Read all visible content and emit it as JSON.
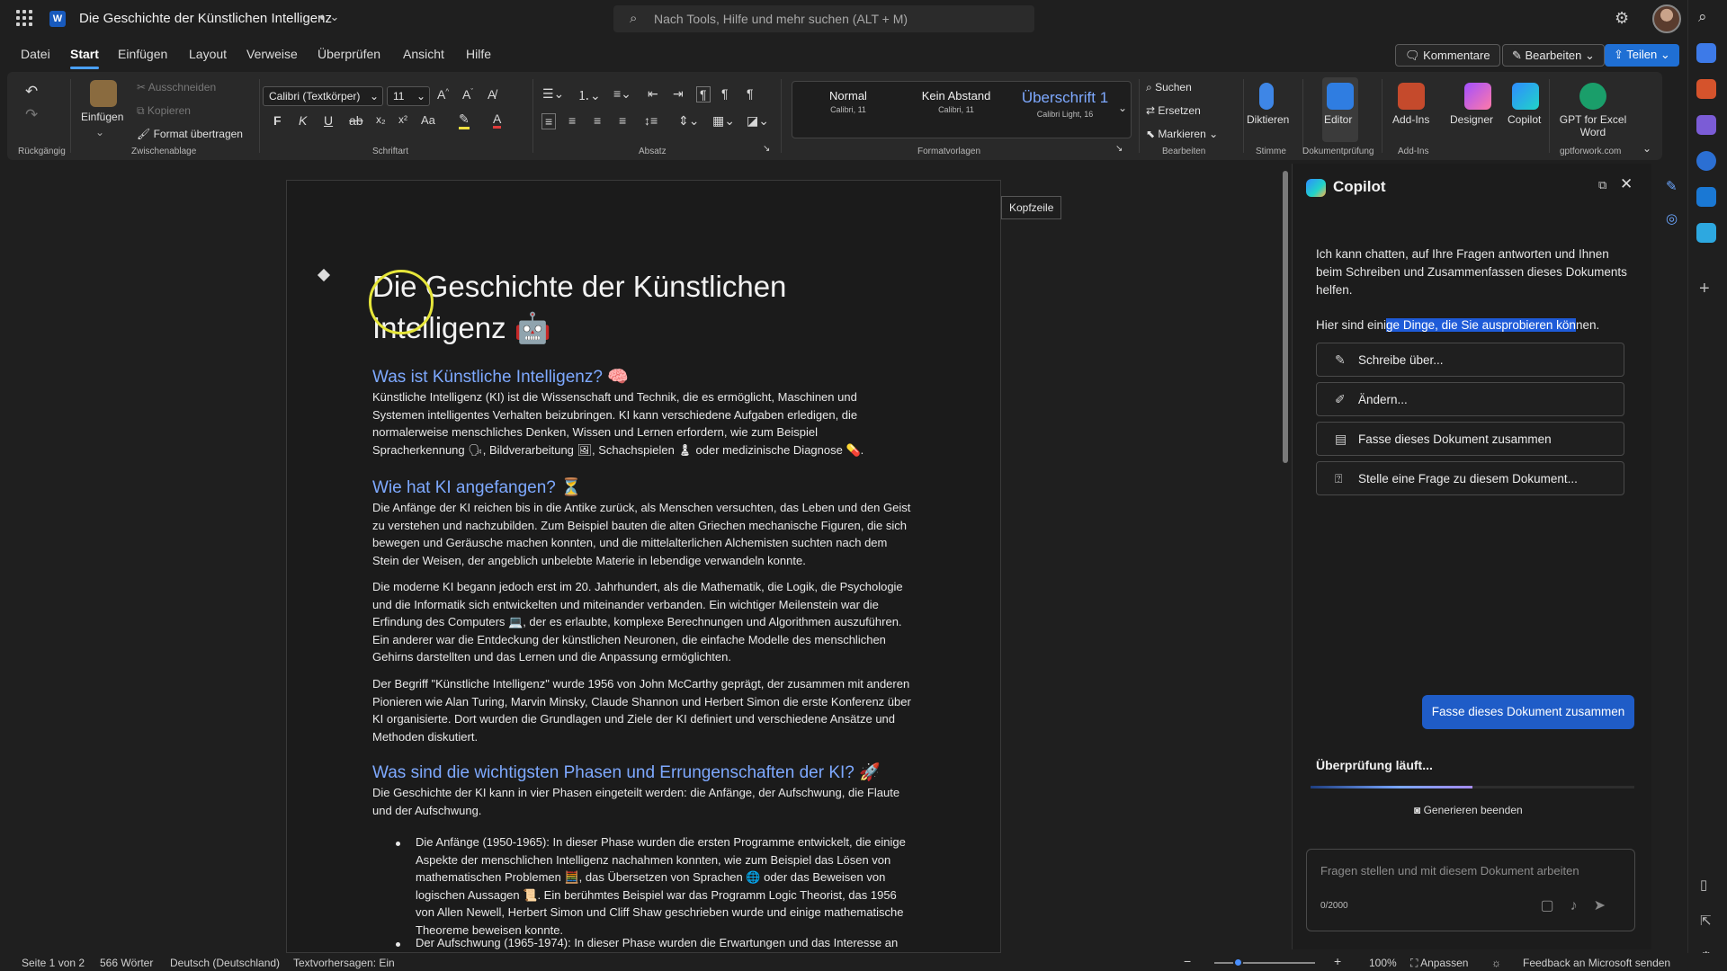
{
  "titlebar": {
    "doc_title": "Die Geschichte der Künstlichen Intelligenz",
    "search_placeholder": "Nach Tools, Hilfe und mehr suchen (ALT + M)"
  },
  "tabs": [
    "Datei",
    "Start",
    "Einfügen",
    "Layout",
    "Verweise",
    "Überprüfen",
    "Ansicht",
    "Hilfe"
  ],
  "active_tab": "Start",
  "actions": {
    "comments": "Kommentare",
    "edit": "Bearbeiten",
    "share": "Teilen"
  },
  "ribbon": {
    "undo_group": "Rückgängig",
    "clipboard": {
      "paste": "Einfügen",
      "cut": "Ausschneiden",
      "copy": "Kopieren",
      "format_painter": "Format übertragen",
      "group": "Zwischenablage"
    },
    "font": {
      "name": "Calibri (Textkörper)",
      "size": "11",
      "group": "Schriftart",
      "bold": "F",
      "italic": "K",
      "underline": "U",
      "case": "Aa"
    },
    "paragraph": {
      "group": "Absatz"
    },
    "styles": {
      "items": [
        {
          "name": "Normal",
          "sub": "Calibri, 11"
        },
        {
          "name": "Kein Abstand",
          "sub": "Calibri, 11"
        },
        {
          "name": "Überschrift 1",
          "sub": "Calibri Light, 16"
        }
      ],
      "group": "Formatvorlagen"
    },
    "editing": {
      "find": "Suchen",
      "replace": "Ersetzen",
      "select": "Markieren",
      "group": "Bearbeiten"
    },
    "voice": {
      "dictate": "Diktieren",
      "group": "Stimme"
    },
    "review": {
      "editor": "Editor",
      "group": "Dokumentprüfung"
    },
    "addins": {
      "label": "Add-Ins",
      "group": "Add-Ins"
    },
    "designer": "Designer",
    "copilot": "Copilot",
    "gpt": {
      "line1": "GPT for Excel",
      "line2": "Word",
      "group": "gptforwork.com"
    }
  },
  "document": {
    "header_label": "Kopfzeile",
    "title": "Die Geschichte der Künstlichen Intelligenz 🤖",
    "sections": [
      {
        "heading": "Was ist Künstliche Intelligenz? 🧠",
        "paragraphs": [
          "Künstliche Intelligenz (KI) ist die Wissenschaft und Technik, die es ermöglicht, Maschinen und Systemen intelligentes Verhalten beizubringen. KI kann verschiedene Aufgaben erledigen, die normalerweise menschliches Denken, Wissen und Lernen erfordern, wie zum Beispiel Spracherkennung 🗣, Bildverarbeitung 🖼, Schachspielen ♟ oder medizinische Diagnose 💊."
        ]
      },
      {
        "heading": "Wie hat KI angefangen? ⏳",
        "paragraphs": [
          "Die Anfänge der KI reichen bis in die Antike zurück, als Menschen versuchten, das Leben und den Geist zu verstehen und nachzubilden. Zum Beispiel bauten die alten Griechen mechanische Figuren, die sich bewegen und Geräusche machen konnten, und die mittelalterlichen Alchemisten suchten nach dem Stein der Weisen, der angeblich unbelebte Materie in lebendige verwandeln konnte.",
          "Die moderne KI begann jedoch erst im 20. Jahrhundert, als die Mathematik, die Logik, die Psychologie und die Informatik sich entwickelten und miteinander verbanden. Ein wichtiger Meilenstein war die Erfindung des Computers 💻, der es erlaubte, komplexe Berechnungen und Algorithmen auszuführen. Ein anderer war die Entdeckung der künstlichen Neuronen, die einfache Modelle des menschlichen Gehirns darstellten und das Lernen und die Anpassung ermöglichten.",
          "Der Begriff \"Künstliche Intelligenz\" wurde 1956 von John McCarthy geprägt, der zusammen mit anderen Pionieren wie Alan Turing, Marvin Minsky, Claude Shannon und Herbert Simon die erste Konferenz über KI organisierte. Dort wurden die Grundlagen und Ziele der KI definiert und verschiedene Ansätze und Methoden diskutiert."
        ]
      },
      {
        "heading": "Was sind die wichtigsten Phasen und Errungenschaften der KI? 🚀",
        "paragraphs": [
          "Die Geschichte der KI kann in vier Phasen eingeteilt werden: die Anfänge, der Aufschwung, die Flaute und der Aufschwung."
        ],
        "bullets": [
          "Die Anfänge (1950-1965): In dieser Phase wurden die ersten Programme entwickelt, die einige Aspekte der menschlichen Intelligenz nachahmen konnten, wie zum Beispiel das Lösen von mathematischen Problemen 🧮, das Übersetzen von Sprachen 🌐 oder das Beweisen von logischen Aussagen 📜. Ein berühmtes Beispiel war das Programm Logic Theorist, das 1956 von Allen Newell, Herbert Simon und Cliff Shaw geschrieben wurde und einige mathematische Theoreme beweisen konnte.",
          "Der Aufschwung (1965-1974): In dieser Phase wurden die Erwartungen und das Interesse an"
        ]
      }
    ]
  },
  "copilot": {
    "title": "Copilot",
    "intro": "Ich kann chatten, auf Ihre Fragen antworten und Ihnen beim Schreiben und Zusammenfassen dieses Dokuments helfen.",
    "suggest_pre": "Hier sind eini",
    "suggest_hl": "ge Dinge, die Sie ausprobieren kön",
    "suggest_post": "nen.",
    "prompts": [
      {
        "icon": "write-icon",
        "label": "Schreibe über..."
      },
      {
        "icon": "pen-icon",
        "label": "Ändern..."
      },
      {
        "icon": "summary-icon",
        "label": "Fasse dieses Dokument zusammen"
      },
      {
        "icon": "question-icon",
        "label": "Stelle eine Frage zu diesem Dokument..."
      }
    ],
    "user_message": "Fasse dieses Dokument zusammen",
    "status": "Überprüfung läuft...",
    "progress": 0.5,
    "stop_label": "Generieren beenden",
    "input_placeholder": "Fragen stellen und mit diesem Dokument arbeiten",
    "char_count": "0/2000"
  },
  "statusbar": {
    "page": "Seite 1 von 2",
    "words": "566 Wörter",
    "language": "Deutsch (Deutschland)",
    "prediction": "Textvorhersagen: Ein",
    "zoom": "100%",
    "fit": "Anpassen",
    "feedback": "Feedback an Microsoft senden"
  },
  "colors": {
    "accent": "#1f6fd4",
    "heading": "#7ea9ff",
    "background": "#1f1f1f"
  }
}
